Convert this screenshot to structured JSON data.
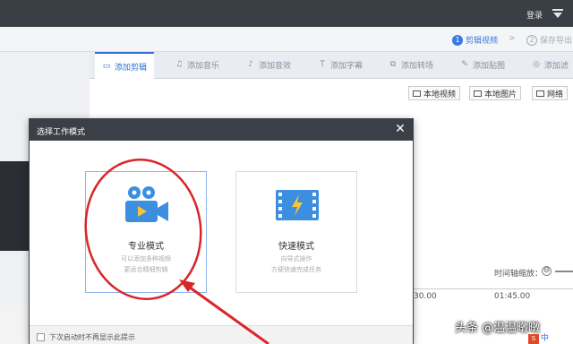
{
  "titlebar": {
    "login": "登录",
    "menu_icon": "dropdown-menu-icon"
  },
  "steps": {
    "step1": {
      "num": "1",
      "label": "剪辑视频"
    },
    "separator": ">",
    "step2": {
      "num": "2",
      "label": "保存导出"
    }
  },
  "tabs": [
    {
      "label": "添加剪辑",
      "icon": "video-camera-icon",
      "glyph": "▭"
    },
    {
      "label": "添加音乐",
      "icon": "music-icon",
      "glyph": "♫"
    },
    {
      "label": "添加音效",
      "icon": "sound-effect-icon",
      "glyph": "♪"
    },
    {
      "label": "添加字幕",
      "icon": "text-icon",
      "glyph": "T"
    },
    {
      "label": "添加转场",
      "icon": "transition-icon",
      "glyph": "⧉"
    },
    {
      "label": "添加贴图",
      "icon": "sticker-icon",
      "glyph": "✎"
    },
    {
      "label": "添加滤",
      "icon": "filter-icon",
      "glyph": "◎"
    }
  ],
  "source_buttons": [
    "本地视频",
    "本地图片",
    "网络"
  ],
  "timeline": {
    "zoom_label": "时间轴缩放：",
    "zoom_minus": "⊖",
    "tick1": "30.00",
    "tick2": "01:45.00"
  },
  "dialog": {
    "title": "选择工作模式",
    "close": "✕",
    "pro": {
      "title": "专业模式",
      "desc1": "可以添加多种视频",
      "desc2": "更适合精细剪辑"
    },
    "quick": {
      "title": "快速模式",
      "desc1": "向导式操作",
      "desc2": "方便快速完成任务"
    },
    "footer_checkbox": "下次启动时不再显示此提示"
  },
  "colors": {
    "accent": "#2f6fd6",
    "annotation_red": "#d9262a",
    "titlebar": "#3a3f45"
  },
  "overlay": {
    "watermark": "头条 @温温暾暾",
    "ime1": "S",
    "ime2": "中"
  }
}
